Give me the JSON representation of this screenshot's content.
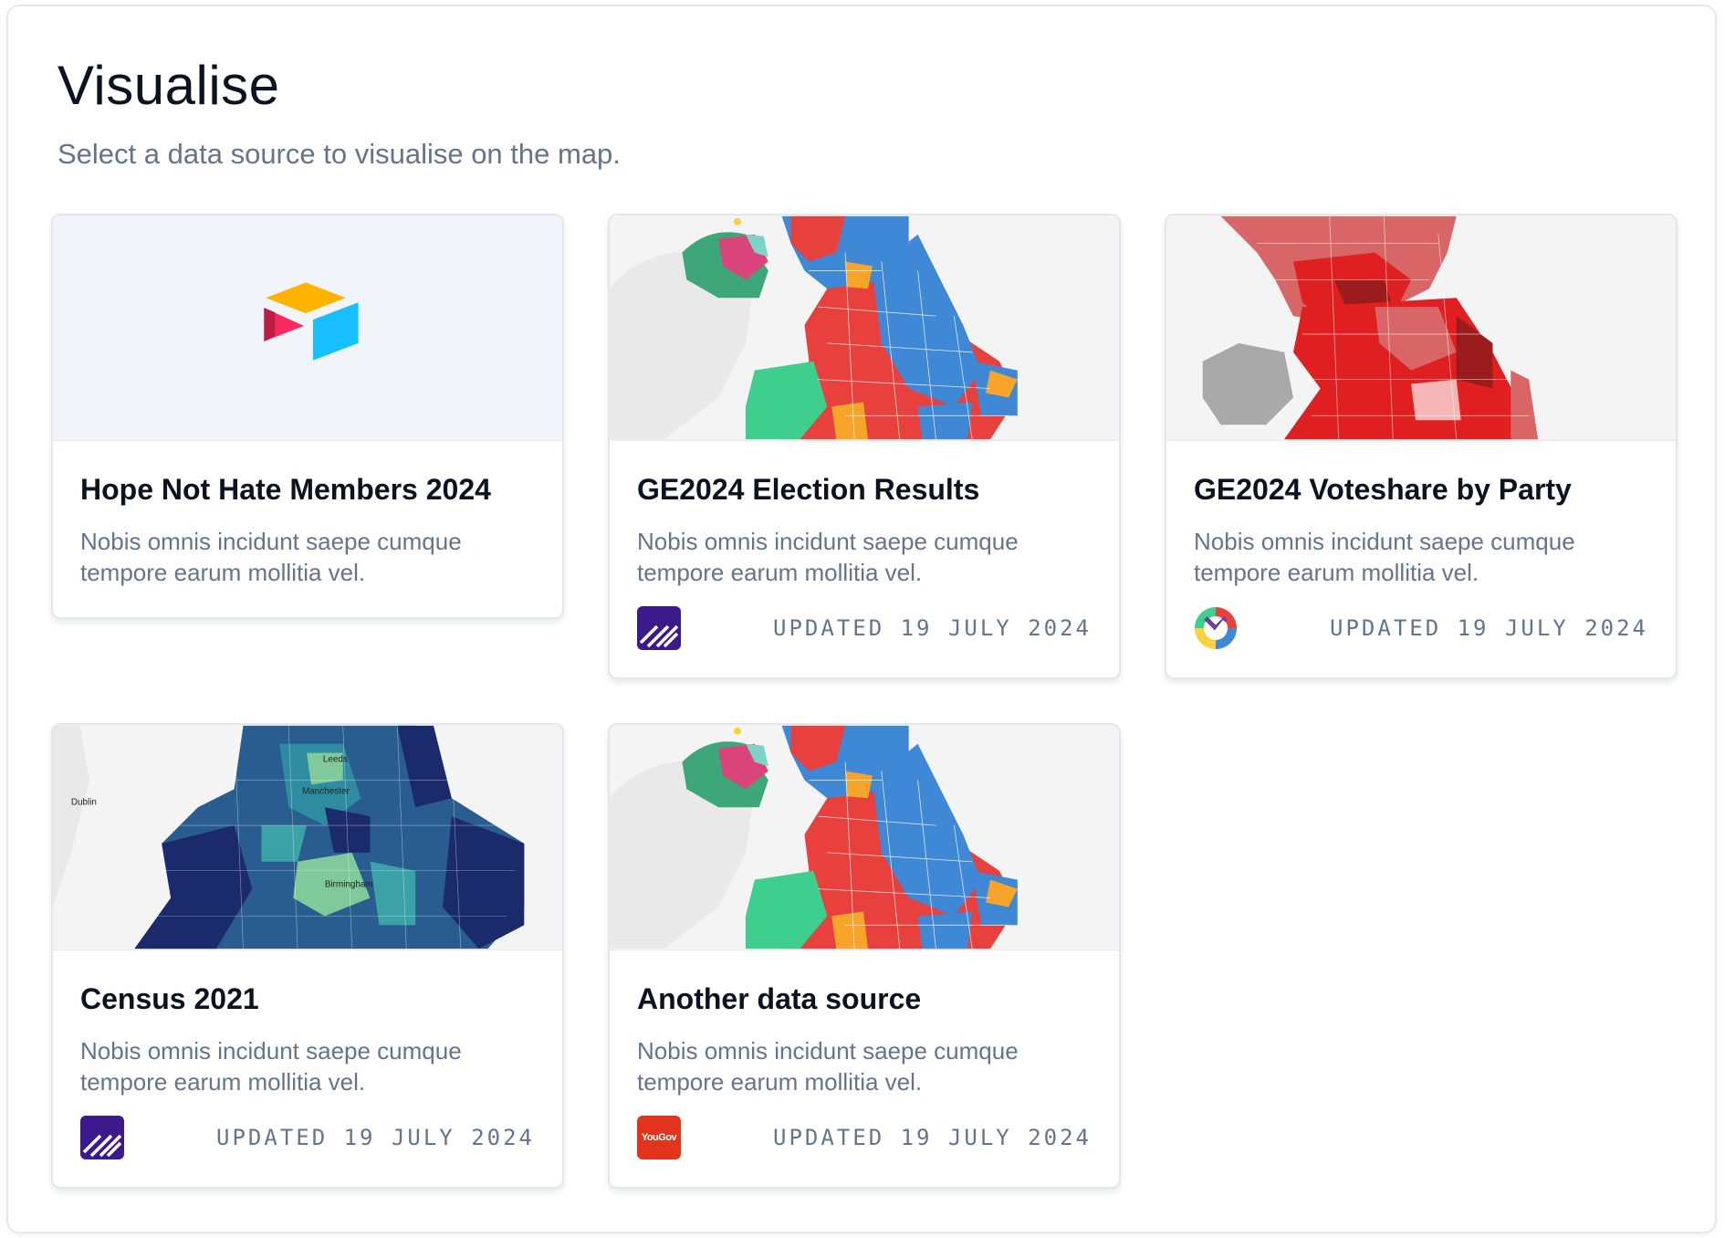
{
  "page": {
    "title": "Visualise",
    "subtitle": "Select a data source to visualise on the map."
  },
  "cards": [
    {
      "title": "Hope Not Hate Members 2024",
      "description": "Nobis omnis incidunt saepe cumque tempore earum mollitia vel.",
      "media": "airtable-logo",
      "logo": null,
      "updated": null
    },
    {
      "title": "GE2024 Election Results",
      "description": "Nobis omnis incidunt saepe cumque tempore earum mollitia vel.",
      "media": "election-results-map",
      "logo": "stripes-logo-icon",
      "updated": "UPDATED 19 JULY 2024"
    },
    {
      "title": "GE2024 Voteshare by Party",
      "description": "Nobis omnis incidunt saepe cumque tempore earum mollitia vel.",
      "media": "voteshare-map",
      "logo": "multicolor-ring-logo-icon",
      "updated": "UPDATED 19 JULY 2024"
    },
    {
      "title": "Census 2021",
      "description": "Nobis omnis incidunt saepe cumque tempore earum mollitia vel.",
      "media": "census-map",
      "map_labels": [
        "Dublin",
        "Leeds",
        "Manchester",
        "Birmingham"
      ],
      "logo": "stripes-logo-icon",
      "updated": "UPDATED 19 JULY 2024"
    },
    {
      "title": "Another data source",
      "description": "Nobis omnis incidunt saepe cumque tempore earum mollitia vel.",
      "media": "election-results-map",
      "logo": "yougov-logo-icon",
      "logo_text": "YouGov",
      "updated": "UPDATED 19 JULY 2024"
    }
  ],
  "colors": {
    "labour": "#e8403c",
    "conservative": "#3f88d6",
    "libdem": "#f7a52a",
    "plaid": "#3ecf8e",
    "snp": "#f7d23e",
    "stripes_logo": "#3c1a8c",
    "yougov": "#e2341d"
  }
}
